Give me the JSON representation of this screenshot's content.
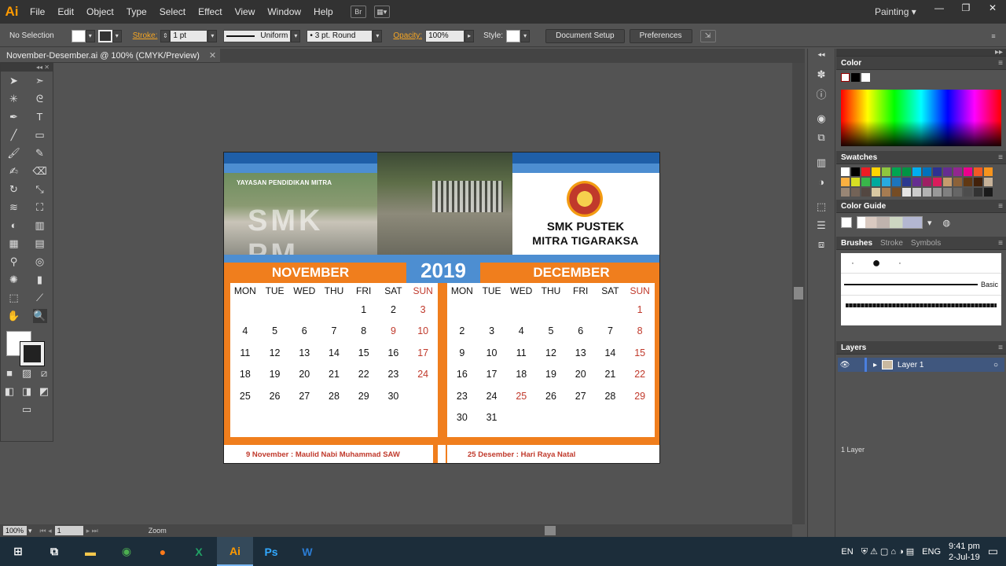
{
  "menubar": {
    "logo": "Ai",
    "items": [
      "File",
      "Edit",
      "Object",
      "Type",
      "Select",
      "Effect",
      "View",
      "Window",
      "Help"
    ],
    "bridge_label": "Br",
    "workspace": "Painting"
  },
  "controlbar": {
    "selection": "No Selection",
    "stroke_label": "Stroke:",
    "stroke_weight": "1 pt",
    "profile": "Uniform",
    "brush": "3 pt. Round",
    "opacity_label": "Opacity:",
    "opacity": "100%",
    "style_label": "Style:",
    "document_setup": "Document Setup",
    "preferences": "Preferences"
  },
  "document": {
    "tab_title": "November-Desember.ai @ 100% (CMYK/Preview)"
  },
  "statusbar": {
    "zoom": "100%",
    "artboard": "1",
    "mode": "Zoom"
  },
  "calendar": {
    "foundation": "YAYASAN PENDIDIKAN MITRA",
    "photo_text": "SMK PM",
    "school_line1": "SMK PUSTEK",
    "school_line2": "MITRA TIGARAKSA",
    "year": "2019",
    "weekdays": [
      "MON",
      "TUE",
      "WED",
      "THU",
      "FRI",
      "SAT",
      "SUN"
    ],
    "november": {
      "title": "NOVEMBER",
      "days": [
        "",
        "",
        "",
        "",
        "1",
        "2",
        "3",
        "4",
        "5",
        "6",
        "7",
        "8",
        "9",
        "10",
        "11",
        "12",
        "13",
        "14",
        "15",
        "16",
        "17",
        "18",
        "19",
        "20",
        "21",
        "22",
        "23",
        "24",
        "25",
        "26",
        "27",
        "28",
        "29",
        "30",
        ""
      ],
      "red_days": [
        "3",
        "9",
        "10",
        "17",
        "24"
      ],
      "holiday": "9 November : Maulid Nabi Muhammad SAW"
    },
    "december": {
      "title": "DECEMBER",
      "days": [
        "",
        "",
        "",
        "",
        "",
        "",
        "1",
        "2",
        "3",
        "4",
        "5",
        "6",
        "7",
        "8",
        "9",
        "10",
        "11",
        "12",
        "13",
        "14",
        "15",
        "16",
        "17",
        "18",
        "19",
        "20",
        "21",
        "22",
        "23",
        "24",
        "25",
        "26",
        "27",
        "28",
        "29",
        "30",
        "31",
        "",
        "",
        "",
        "",
        ""
      ],
      "red_days": [
        "1",
        "8",
        "15",
        "22",
        "25",
        "29"
      ],
      "holiday": "25 Desember : Hari Raya Natal"
    }
  },
  "panels": {
    "color": "Color",
    "swatches": "Swatches",
    "color_guide": "Color Guide",
    "brushes": "Brushes",
    "stroke": "Stroke",
    "symbols": "Symbols",
    "brush_basic": "Basic",
    "layers": "Layers",
    "layer_name": "Layer 1",
    "layer_count": "1 Layer"
  },
  "taskbar": {
    "lang_short": "EN",
    "lang": "ENG",
    "time": "9:41 pm",
    "date": "2-Jul-19"
  },
  "colors": {
    "calendar_blue": "#4d8ed1",
    "calendar_orange": "#f07e1d",
    "holiday_red": "#c0392b",
    "ai_orange": "#ff9a00"
  }
}
